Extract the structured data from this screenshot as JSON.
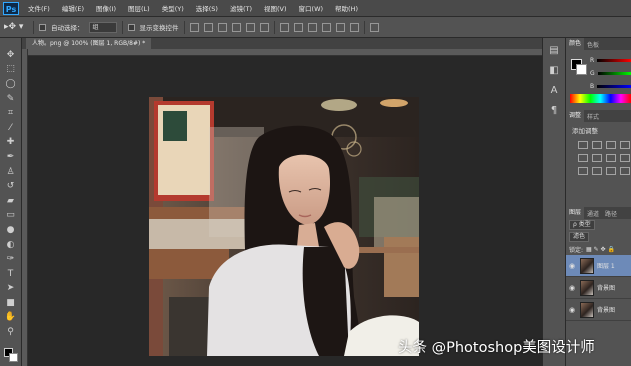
{
  "app": {
    "logo": "Ps",
    "menu": [
      "文件(F)",
      "编辑(E)",
      "图像(I)",
      "图层(L)",
      "类型(Y)",
      "选择(S)",
      "滤镜(T)",
      "视图(V)",
      "窗口(W)",
      "帮助(H)"
    ]
  },
  "options": {
    "auto_select_label": "自动选择：",
    "auto_select_value": "组",
    "show_transform_label": "显示变换控件"
  },
  "document": {
    "tab_label": "人物。png @ 100% (图层 1, RGB/8#) *"
  },
  "panels": {
    "color_tabs": [
      "颜色",
      "色板"
    ],
    "channels": [
      "R",
      "G",
      "B"
    ],
    "adjust_tabs": [
      "调整",
      "样式"
    ],
    "adjust_add": "添加调整",
    "layer_tabs": [
      "图层",
      "通道",
      "路径"
    ],
    "kind_filter": "ρ 类型",
    "blend_mode": "滤色",
    "lock_label": "锁定:",
    "layers": [
      {
        "name": "图层 1",
        "selected": true
      },
      {
        "name": "背景图",
        "selected": false
      },
      {
        "name": "背景图",
        "selected": false
      }
    ]
  },
  "watermark": "头条 @Photoshop美图设计师",
  "colors": {
    "foreground": "#000000",
    "background": "#ffffff",
    "selection": "#6d8ab8"
  }
}
